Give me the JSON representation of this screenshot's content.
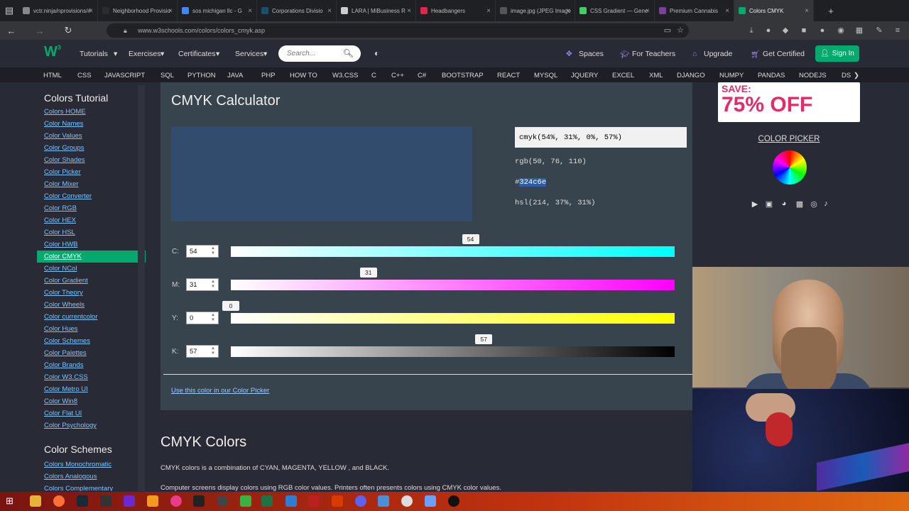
{
  "browser": {
    "tabs": [
      {
        "title": "vctr.ninja/nprovisions/#",
        "color": "#888888"
      },
      {
        "title": "Neighborhood Provisio",
        "color": "#2c2c2c"
      },
      {
        "title": "sos michigan llc - G",
        "color": "#4285f4"
      },
      {
        "title": "Corporations Divisio",
        "color": "#1b4f72"
      },
      {
        "title": "LARA | MiBusiness R",
        "color": "#cccccc"
      },
      {
        "title": "Headbangers",
        "color": "#e0244c"
      },
      {
        "title": "image.jpg (JPEG Image",
        "color": "#555555"
      },
      {
        "title": "CSS Gradient — Gene",
        "color": "#44cc66"
      },
      {
        "title": "Premium Cannabis",
        "color": "#7b3f9e"
      },
      {
        "title": "Colors CMYK",
        "color": "#04aa6d"
      }
    ],
    "url": "www.w3schools.com/colors/colors_cmyk.asp"
  },
  "topnav": {
    "tutorials": "Tutorials",
    "exercises": "Exercises",
    "certificates": "Certificates",
    "services": "Services",
    "search_placeholder": "Search...",
    "spaces": "Spaces",
    "for_teachers": "For Teachers",
    "upgrade": "Upgrade",
    "get_certified": "Get Certified",
    "sign_in": "Sign In"
  },
  "langbar": [
    "HTML",
    "CSS",
    "JAVASCRIPT",
    "SQL",
    "PYTHON",
    "JAVA",
    "PHP",
    "HOW TO",
    "W3.CSS",
    "C",
    "C++",
    "C#",
    "BOOTSTRAP",
    "REACT",
    "MYSQL",
    "JQUERY",
    "EXCEL",
    "XML",
    "DJANGO",
    "NUMPY",
    "PANDAS",
    "NODEJS",
    "DS"
  ],
  "sidebar": {
    "heading": "Colors Tutorial",
    "items": [
      "Colors HOME",
      "Color Names",
      "Color Values",
      "Color Groups",
      "Color Shades",
      "Color Picker",
      "Color Mixer",
      "Color Converter",
      "Color RGB",
      "Color HEX",
      "Color HSL",
      "Color HWB",
      "Color CMYK",
      "Color NCol",
      "Color Gradient",
      "Color Theory",
      "Color Wheels",
      "Color currentcolor",
      "Color Hues",
      "Color Schemes",
      "Color Palettes",
      "Color Brands",
      "Color W3.CSS",
      "Color Metro UI",
      "Color Win8",
      "Color Flat UI",
      "Color Psychology"
    ],
    "active_index": 12,
    "heading2": "Color Schemes",
    "items2": [
      "Colors Monochromatic",
      "Colors Analogous",
      "Colors Complementary"
    ]
  },
  "calculator": {
    "title": "CMYK Calculator",
    "swatch_color": "#324c6e",
    "cmyk": "cmyk(54%, 31%, 0%, 57%)",
    "rgb": "rgb(50, 76, 110)",
    "hex_hash": "#",
    "hex_rest": "324c6e",
    "hsl": "hsl(214, 37%, 31%)",
    "sliders": [
      {
        "label": "C:",
        "value": "54",
        "fraction": 0.54,
        "gradient": "linear-gradient(90deg,#ffffff,#00ffff)"
      },
      {
        "label": "M:",
        "value": "31",
        "fraction": 0.31,
        "gradient": "linear-gradient(90deg,#ffffff,#ff00ff)"
      },
      {
        "label": "Y:",
        "value": "0",
        "fraction": 0.0,
        "gradient": "linear-gradient(90deg,#ffffff,#ffff00)"
      },
      {
        "label": "K:",
        "value": "57",
        "fraction": 0.57,
        "gradient": "linear-gradient(90deg,#ffffff,#000000)"
      }
    ],
    "use_link": "Use this color in our Color Picker"
  },
  "section": {
    "title": "CMYK Colors",
    "p1": "CMYK colors is a combination of CYAN, MAGENTA, YELLOW , and BLACK.",
    "p2": "Computer screens display colors using RGB color values. Printers often presents colors using CMYK color values."
  },
  "ad": {
    "line1": "SAVE:",
    "line2": "75% OFF"
  },
  "right": {
    "color_picker": "COLOR PICKER"
  }
}
